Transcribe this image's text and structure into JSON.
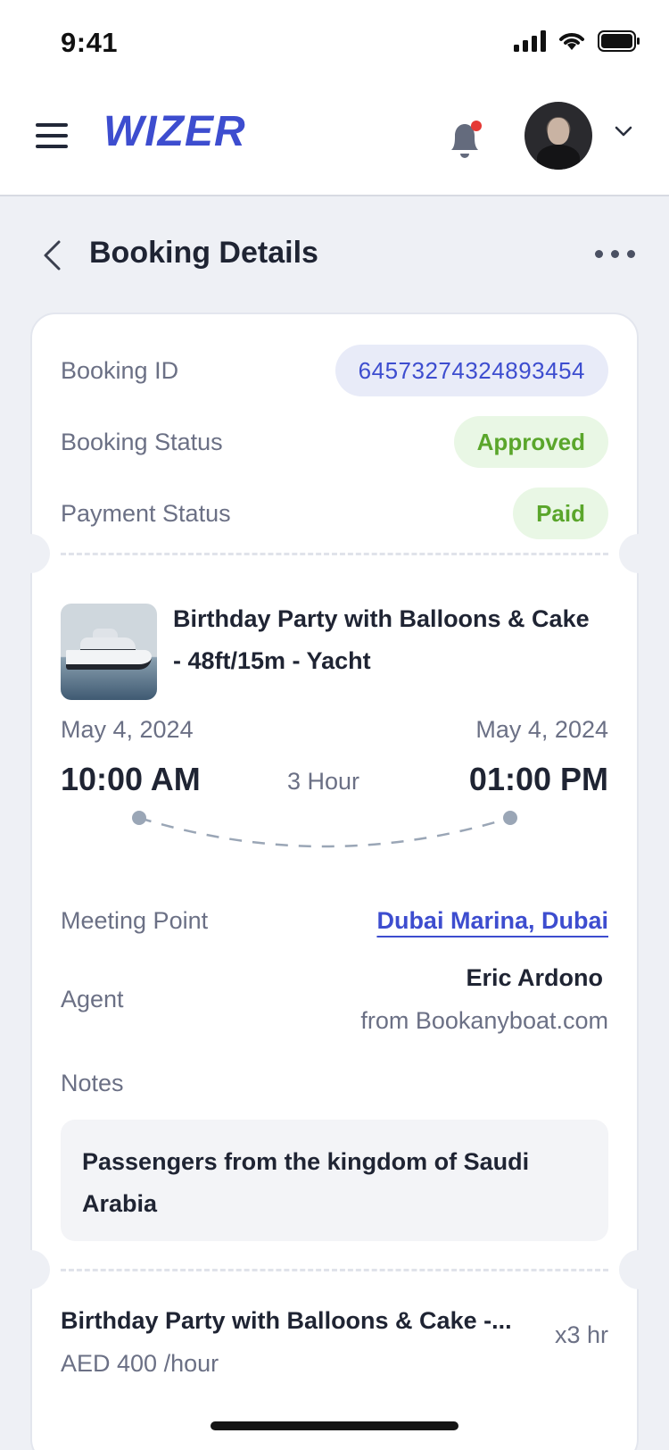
{
  "status_bar": {
    "time": "9:41"
  },
  "app_bar": {
    "logo_text": "WIZER"
  },
  "page": {
    "title": "Booking Details"
  },
  "booking": {
    "id_label": "Booking ID",
    "id_value": "64573274324893454",
    "status_label": "Booking Status",
    "status_value": "Approved",
    "payment_label": "Payment Status",
    "payment_value": "Paid"
  },
  "trip": {
    "title": "Birthday Party with Balloons & Cake - 48ft/15m - Yacht",
    "start_date": "May 4, 2024",
    "start_time": "10:00 AM",
    "duration": "3 Hour",
    "end_date": "May 4, 2024",
    "end_time": "01:00 PM"
  },
  "details": {
    "meeting_label": "Meeting Point",
    "meeting_value": "Dubai Marina, Dubai",
    "agent_label": "Agent",
    "agent_name": "Eric Ardono",
    "agent_from": "from Bookanyboat.com",
    "notes_label": "Notes",
    "notes_text": "Passengers from the kingdom of Saudi Arabia"
  },
  "line_item": {
    "title": "Birthday Party with Balloons & Cake -...",
    "price": "AED 400 /hour",
    "qty": "x3 hr"
  },
  "colors": {
    "brand": "#3d4dcf",
    "success": "#5aa62b",
    "notification_dot": "#e53935"
  }
}
